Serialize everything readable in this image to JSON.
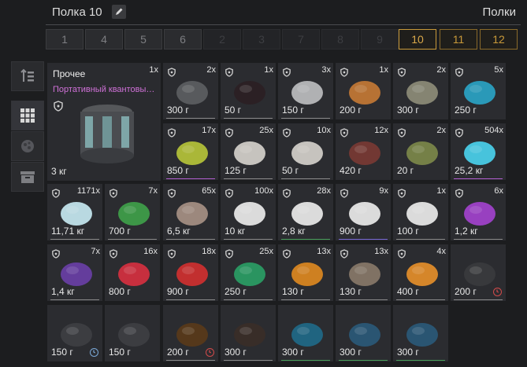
{
  "header": {
    "shelf_title": "Полка 10",
    "shelves_label": "Полки"
  },
  "tabs": [
    "1",
    "4",
    "5",
    "6",
    "2",
    "3",
    "7",
    "8",
    "9",
    "10",
    "11",
    "12"
  ],
  "big_item": {
    "name": "Прочее",
    "subtitle": "Портативный квантовы…",
    "qty": "1x",
    "weight": "3 кг"
  },
  "cells": [
    {
      "qty": "2x",
      "weight": "300 г"
    },
    {
      "qty": "1x",
      "weight": "50 г"
    },
    {
      "qty": "3x",
      "weight": "150 г"
    },
    {
      "qty": "1x",
      "weight": "200 г"
    },
    {
      "qty": "2x",
      "weight": "300 г"
    },
    {
      "qty": "5x",
      "weight": "250 г"
    },
    {
      "qty": "17x",
      "weight": "850 г"
    },
    {
      "qty": "25x",
      "weight": "125 г"
    },
    {
      "qty": "10x",
      "weight": "50 г"
    },
    {
      "qty": "12x",
      "weight": "420 г"
    },
    {
      "qty": "2x",
      "weight": "20 г"
    },
    {
      "qty": "504x",
      "weight": "25,2 кг"
    },
    {
      "qty": "1171x",
      "weight": "11,71 кг"
    },
    {
      "qty": "7x",
      "weight": "700 г"
    },
    {
      "qty": "65x",
      "weight": "6,5 кг"
    },
    {
      "qty": "100x",
      "weight": "10 кг"
    },
    {
      "qty": "28x",
      "weight": "2,8 кг"
    },
    {
      "qty": "9x",
      "weight": "900 г"
    },
    {
      "qty": "1x",
      "weight": "100 г"
    },
    {
      "qty": "6x",
      "weight": "1,2 кг"
    },
    {
      "qty": "7x",
      "weight": "1,4 кг"
    },
    {
      "qty": "16x",
      "weight": "800 г"
    },
    {
      "qty": "18x",
      "weight": "900 г"
    },
    {
      "qty": "25x",
      "weight": "250 г"
    },
    {
      "qty": "13x",
      "weight": "130 г"
    },
    {
      "qty": "13x",
      "weight": "130 г"
    },
    {
      "qty": "4x",
      "weight": "400 г"
    },
    {
      "qty": "",
      "weight": "200 г"
    },
    {
      "qty": "",
      "weight": "150 г"
    },
    {
      "qty": "",
      "weight": "150 г"
    },
    {
      "qty": "",
      "weight": "200 г"
    },
    {
      "qty": "",
      "weight": "300 г"
    },
    {
      "qty": "",
      "weight": "300 г"
    },
    {
      "qty": "",
      "weight": "300 г"
    },
    {
      "qty": "",
      "weight": "300 г"
    }
  ],
  "colors": {
    "accent": "#c99a3a",
    "rarity_purple": "#b25fd0",
    "timer_red": "#d24a4a",
    "timer_blue": "#7aa8d6"
  }
}
